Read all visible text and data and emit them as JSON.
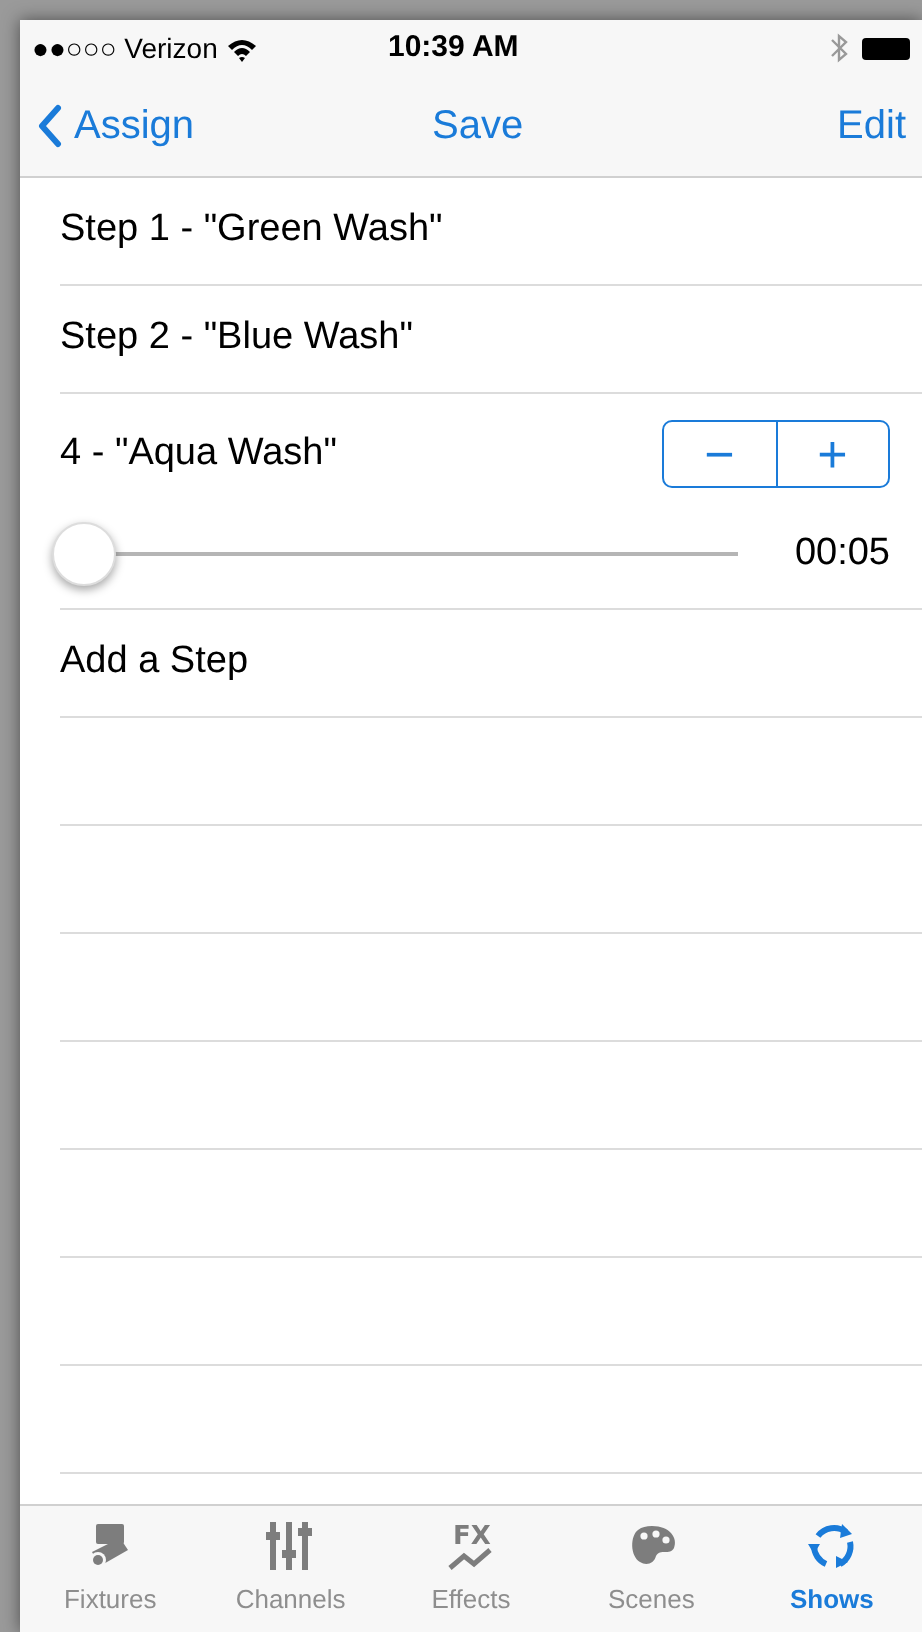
{
  "status_bar": {
    "carrier": "●●○○○ Verizon",
    "time": "10:39 AM"
  },
  "nav": {
    "back": "Assign",
    "title": "Save",
    "action": "Edit"
  },
  "steps": [
    {
      "kind": "plain",
      "label": "Step 1 - \"Green Wash\""
    },
    {
      "kind": "plain",
      "label": "Step 2 - \"Blue Wash\""
    },
    {
      "kind": "editing",
      "label": "4 - \"Aqua Wash\"",
      "stepper": {
        "minus": "−",
        "plus": "+"
      },
      "level": 0.0,
      "reading": "00:05"
    },
    {
      "kind": "plain",
      "label": "Add a Step"
    }
  ],
  "tabs": [
    {
      "kind": "fixtures",
      "label": "Fixtures",
      "selected": false
    },
    {
      "kind": "channels",
      "label": "Channels",
      "selected": false
    },
    {
      "kind": "effects",
      "label": "Effects",
      "icon_text": "FX",
      "selected": false
    },
    {
      "kind": "scenes",
      "label": "Scenes",
      "selected": false
    },
    {
      "kind": "shows",
      "label": "Shows",
      "selected": true
    }
  ]
}
